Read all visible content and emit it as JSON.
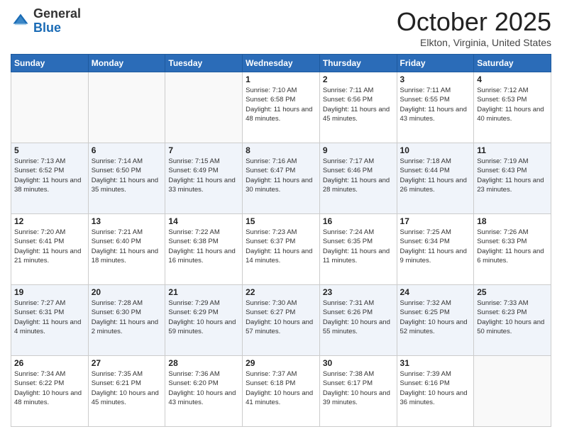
{
  "logo": {
    "general": "General",
    "blue": "Blue"
  },
  "header": {
    "month": "October 2025",
    "location": "Elkton, Virginia, United States"
  },
  "weekdays": [
    "Sunday",
    "Monday",
    "Tuesday",
    "Wednesday",
    "Thursday",
    "Friday",
    "Saturday"
  ],
  "weeks": [
    [
      {
        "day": "",
        "sunrise": "",
        "sunset": "",
        "daylight": ""
      },
      {
        "day": "",
        "sunrise": "",
        "sunset": "",
        "daylight": ""
      },
      {
        "day": "",
        "sunrise": "",
        "sunset": "",
        "daylight": ""
      },
      {
        "day": "1",
        "sunrise": "Sunrise: 7:10 AM",
        "sunset": "Sunset: 6:58 PM",
        "daylight": "Daylight: 11 hours and 48 minutes."
      },
      {
        "day": "2",
        "sunrise": "Sunrise: 7:11 AM",
        "sunset": "Sunset: 6:56 PM",
        "daylight": "Daylight: 11 hours and 45 minutes."
      },
      {
        "day": "3",
        "sunrise": "Sunrise: 7:11 AM",
        "sunset": "Sunset: 6:55 PM",
        "daylight": "Daylight: 11 hours and 43 minutes."
      },
      {
        "day": "4",
        "sunrise": "Sunrise: 7:12 AM",
        "sunset": "Sunset: 6:53 PM",
        "daylight": "Daylight: 11 hours and 40 minutes."
      }
    ],
    [
      {
        "day": "5",
        "sunrise": "Sunrise: 7:13 AM",
        "sunset": "Sunset: 6:52 PM",
        "daylight": "Daylight: 11 hours and 38 minutes."
      },
      {
        "day": "6",
        "sunrise": "Sunrise: 7:14 AM",
        "sunset": "Sunset: 6:50 PM",
        "daylight": "Daylight: 11 hours and 35 minutes."
      },
      {
        "day": "7",
        "sunrise": "Sunrise: 7:15 AM",
        "sunset": "Sunset: 6:49 PM",
        "daylight": "Daylight: 11 hours and 33 minutes."
      },
      {
        "day": "8",
        "sunrise": "Sunrise: 7:16 AM",
        "sunset": "Sunset: 6:47 PM",
        "daylight": "Daylight: 11 hours and 30 minutes."
      },
      {
        "day": "9",
        "sunrise": "Sunrise: 7:17 AM",
        "sunset": "Sunset: 6:46 PM",
        "daylight": "Daylight: 11 hours and 28 minutes."
      },
      {
        "day": "10",
        "sunrise": "Sunrise: 7:18 AM",
        "sunset": "Sunset: 6:44 PM",
        "daylight": "Daylight: 11 hours and 26 minutes."
      },
      {
        "day": "11",
        "sunrise": "Sunrise: 7:19 AM",
        "sunset": "Sunset: 6:43 PM",
        "daylight": "Daylight: 11 hours and 23 minutes."
      }
    ],
    [
      {
        "day": "12",
        "sunrise": "Sunrise: 7:20 AM",
        "sunset": "Sunset: 6:41 PM",
        "daylight": "Daylight: 11 hours and 21 minutes."
      },
      {
        "day": "13",
        "sunrise": "Sunrise: 7:21 AM",
        "sunset": "Sunset: 6:40 PM",
        "daylight": "Daylight: 11 hours and 18 minutes."
      },
      {
        "day": "14",
        "sunrise": "Sunrise: 7:22 AM",
        "sunset": "Sunset: 6:38 PM",
        "daylight": "Daylight: 11 hours and 16 minutes."
      },
      {
        "day": "15",
        "sunrise": "Sunrise: 7:23 AM",
        "sunset": "Sunset: 6:37 PM",
        "daylight": "Daylight: 11 hours and 14 minutes."
      },
      {
        "day": "16",
        "sunrise": "Sunrise: 7:24 AM",
        "sunset": "Sunset: 6:35 PM",
        "daylight": "Daylight: 11 hours and 11 minutes."
      },
      {
        "day": "17",
        "sunrise": "Sunrise: 7:25 AM",
        "sunset": "Sunset: 6:34 PM",
        "daylight": "Daylight: 11 hours and 9 minutes."
      },
      {
        "day": "18",
        "sunrise": "Sunrise: 7:26 AM",
        "sunset": "Sunset: 6:33 PM",
        "daylight": "Daylight: 11 hours and 6 minutes."
      }
    ],
    [
      {
        "day": "19",
        "sunrise": "Sunrise: 7:27 AM",
        "sunset": "Sunset: 6:31 PM",
        "daylight": "Daylight: 11 hours and 4 minutes."
      },
      {
        "day": "20",
        "sunrise": "Sunrise: 7:28 AM",
        "sunset": "Sunset: 6:30 PM",
        "daylight": "Daylight: 11 hours and 2 minutes."
      },
      {
        "day": "21",
        "sunrise": "Sunrise: 7:29 AM",
        "sunset": "Sunset: 6:29 PM",
        "daylight": "Daylight: 10 hours and 59 minutes."
      },
      {
        "day": "22",
        "sunrise": "Sunrise: 7:30 AM",
        "sunset": "Sunset: 6:27 PM",
        "daylight": "Daylight: 10 hours and 57 minutes."
      },
      {
        "day": "23",
        "sunrise": "Sunrise: 7:31 AM",
        "sunset": "Sunset: 6:26 PM",
        "daylight": "Daylight: 10 hours and 55 minutes."
      },
      {
        "day": "24",
        "sunrise": "Sunrise: 7:32 AM",
        "sunset": "Sunset: 6:25 PM",
        "daylight": "Daylight: 10 hours and 52 minutes."
      },
      {
        "day": "25",
        "sunrise": "Sunrise: 7:33 AM",
        "sunset": "Sunset: 6:23 PM",
        "daylight": "Daylight: 10 hours and 50 minutes."
      }
    ],
    [
      {
        "day": "26",
        "sunrise": "Sunrise: 7:34 AM",
        "sunset": "Sunset: 6:22 PM",
        "daylight": "Daylight: 10 hours and 48 minutes."
      },
      {
        "day": "27",
        "sunrise": "Sunrise: 7:35 AM",
        "sunset": "Sunset: 6:21 PM",
        "daylight": "Daylight: 10 hours and 45 minutes."
      },
      {
        "day": "28",
        "sunrise": "Sunrise: 7:36 AM",
        "sunset": "Sunset: 6:20 PM",
        "daylight": "Daylight: 10 hours and 43 minutes."
      },
      {
        "day": "29",
        "sunrise": "Sunrise: 7:37 AM",
        "sunset": "Sunset: 6:18 PM",
        "daylight": "Daylight: 10 hours and 41 minutes."
      },
      {
        "day": "30",
        "sunrise": "Sunrise: 7:38 AM",
        "sunset": "Sunset: 6:17 PM",
        "daylight": "Daylight: 10 hours and 39 minutes."
      },
      {
        "day": "31",
        "sunrise": "Sunrise: 7:39 AM",
        "sunset": "Sunset: 6:16 PM",
        "daylight": "Daylight: 10 hours and 36 minutes."
      },
      {
        "day": "",
        "sunrise": "",
        "sunset": "",
        "daylight": ""
      }
    ]
  ]
}
